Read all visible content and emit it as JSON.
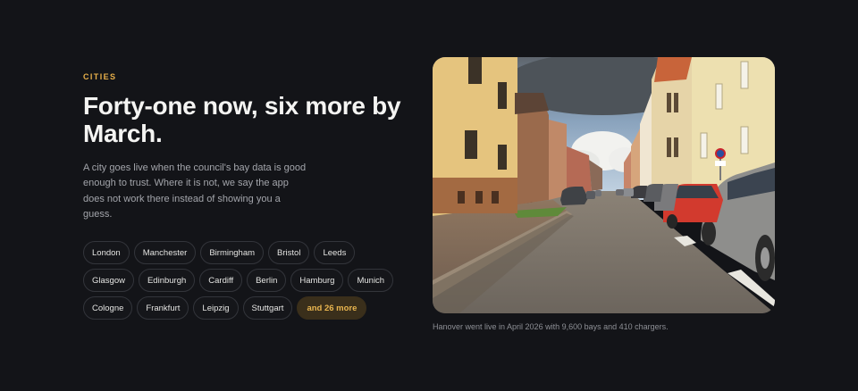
{
  "section": {
    "eyebrow": "CITIES",
    "headline": "Forty-one now, six more by March.",
    "body": "A city goes live when the council's bay data is good enough to trust. Where it is not, we say the app does not work there instead of showing you a guess."
  },
  "cities": {
    "rows": [
      [
        "London",
        "Manchester",
        "Birmingham",
        "Bristol",
        "Leeds"
      ],
      [
        "Glasgow",
        "Edinburgh",
        "Cardiff",
        "Berlin",
        "Hamburg",
        "Munich"
      ],
      [
        "Cologne",
        "Frankfurt",
        "Leipzig",
        "Stuttgart"
      ]
    ],
    "more_label": "and 26 more"
  },
  "photo": {
    "caption": "Hanover went live in April 2026 with 9,600 bays and 410 chargers."
  },
  "colors": {
    "background": "#131418",
    "accent": "#e8b04a",
    "chip_border": "#33353b",
    "more_chip_bg": "#3a2f1b"
  }
}
